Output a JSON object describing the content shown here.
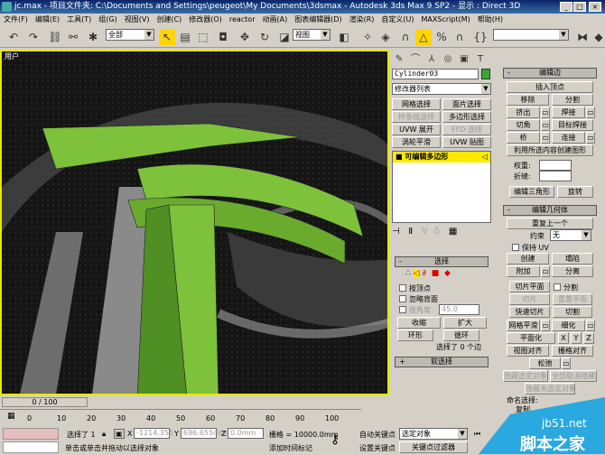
{
  "window": {
    "title": "jc.max  - 项目文件夹: C:\\Documents and Settings\\peugeot\\My Documents\\3dsmax   - Autodesk 3ds Max 9 SP2   - 显示 : Direct 3D"
  },
  "menu": [
    "文件(F)",
    "编辑(E)",
    "工具(T)",
    "组(G)",
    "视图(V)",
    "创建(C)",
    "修改器(O)",
    "reactor",
    "动画(A)",
    "图表编辑器(D)",
    "渲染(R)",
    "自定义(U)",
    "MAXScript(M)",
    "帮助(H)"
  ],
  "toolbar": {
    "selection_filter": "全部",
    "reference_coord": "视图",
    "named_selection": ""
  },
  "viewport": {
    "label": "用户"
  },
  "command_panel": {
    "object_name": "Cylinder03",
    "object_color": "#3fa535",
    "modifier_list": "修改器列表",
    "modifier_buttons": [
      {
        "label": "网格选择",
        "enabled": true
      },
      {
        "label": "面片选择",
        "enabled": true
      },
      {
        "label": "样条线选择",
        "enabled": false
      },
      {
        "label": "多边形选择",
        "enabled": true
      },
      {
        "label": "UVW 展开",
        "enabled": true
      },
      {
        "label": "FFD 选择",
        "enabled": false
      },
      {
        "label": "涡轮平滑",
        "enabled": true
      },
      {
        "label": "UVW 贴图",
        "enabled": true
      }
    ],
    "stack_item": "可编辑多边形",
    "selection": {
      "title": "选择",
      "by_vertex": "按顶点",
      "ignore_backfacing": "忽略背面",
      "by_angle": "按角度",
      "angle_value": "45.0",
      "shrink": "收缩",
      "grow": "扩大",
      "ring": "环形",
      "loop": "循环",
      "status": "选择了 0 个边"
    },
    "soft_selection": {
      "title": "软选择"
    },
    "edit_edges": {
      "title": "编辑边",
      "insert_vertex": "插入顶点",
      "remove": "移除",
      "split": "分割",
      "extrude": "挤出",
      "weld": "焊接",
      "chamfer": "切角",
      "target_weld": "目标焊接",
      "bridge": "桥",
      "connect": "连接",
      "create_shape": "利用所选内容创建图形",
      "weight": "权重:",
      "crease": "折缝:",
      "edit_tri": "编辑三角形",
      "turn": "旋转"
    },
    "edit_geometry": {
      "title": "编辑几何体",
      "repeat_last": "重复上一个",
      "constraint_label": "约束",
      "constraint_value": "无",
      "preserve_uv": "保持 UV",
      "create": "创建",
      "collapse": "塌陷",
      "attach": "附加",
      "detach": "分离",
      "slice_plane": "切片平面",
      "split": "分割",
      "slice": "切片",
      "reset_plane": "重置平面",
      "quickslice": "快速切片",
      "cut": "切割",
      "meshsmooth": "网格平滑",
      "tessellate": "细化",
      "make_planar": "平面化",
      "x": "X",
      "y": "Y",
      "z": "Z",
      "view_align": "视图对齐",
      "grid_align": "栅格对齐",
      "relax": "松弛",
      "hide_selected": "隐藏选定对象",
      "unhide_all": "全部取消隐藏",
      "hide_unselected": "隐藏未选定对象",
      "named_sel": "命名选择:",
      "copy": "复制"
    }
  },
  "timeline": {
    "frame": "0 / 100",
    "ticks": [
      "0",
      "10",
      "20",
      "30",
      "40",
      "50",
      "60",
      "70",
      "80",
      "90",
      "100"
    ]
  },
  "status": {
    "selected": "选择了 1",
    "x": "-1214.355",
    "y": "696.655mm",
    "z": "0.0mm",
    "grid": "栅格 = 10000.0mm",
    "prompt": "单击或单击并拖动以选择对象",
    "add_tag": "添加时间标记",
    "auto_key": "自动关键点",
    "set_key": "设置关键点",
    "key_mode": "选定对象",
    "key_filters": "关键点过滤器"
  },
  "watermark": {
    "site": "jb51.net",
    "name": "脚本之家"
  }
}
